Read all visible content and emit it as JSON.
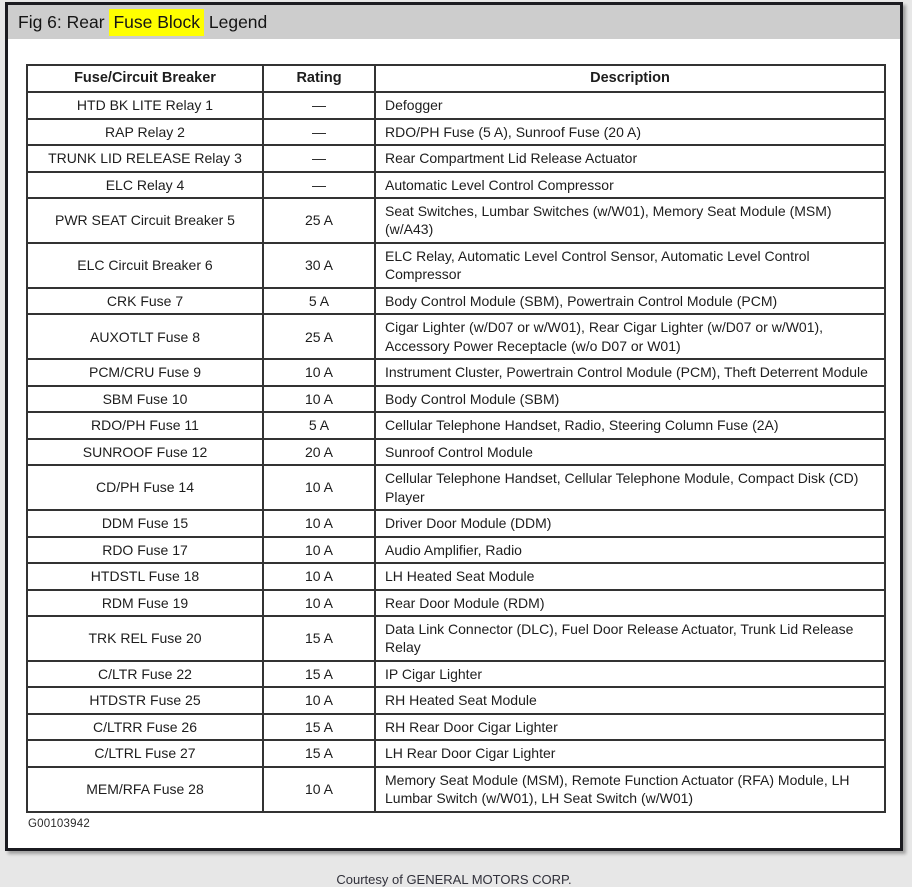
{
  "title": {
    "prefix": "Fig 6: Rear ",
    "highlight": "Fuse Block",
    "suffix": " Legend"
  },
  "colors": {
    "highlight": "#ffff00",
    "title_bar_bg": "#cdcdcd",
    "frame_border": "#1b1b20",
    "table_border": "#333333",
    "page_edge": "#e7e7e7"
  },
  "table": {
    "headers": [
      "Fuse/Circuit Breaker",
      "Rating",
      "Description"
    ],
    "rows": [
      {
        "fuse": "HTD BK LITE Relay 1",
        "rating": "—",
        "description": "Defogger"
      },
      {
        "fuse": "RAP Relay 2",
        "rating": "—",
        "description": "RDO/PH Fuse (5 A), Sunroof Fuse (20 A)"
      },
      {
        "fuse": "TRUNK LID RELEASE Relay 3",
        "rating": "—",
        "description": "Rear Compartment Lid Release Actuator"
      },
      {
        "fuse": "ELC Relay 4",
        "rating": "—",
        "description": "Automatic Level Control Compressor"
      },
      {
        "fuse": "PWR SEAT Circuit Breaker 5",
        "rating": "25 A",
        "description": "Seat Switches, Lumbar Switches (w/W01), Memory Seat Module (MSM) (w/A43)"
      },
      {
        "fuse": "ELC Circuit Breaker 6",
        "rating": "30 A",
        "description": "ELC Relay, Automatic Level Control Sensor, Automatic Level Control Compressor"
      },
      {
        "fuse": "CRK Fuse 7",
        "rating": "5 A",
        "description": "Body Control Module (SBM), Powertrain Control Module (PCM)"
      },
      {
        "fuse": "AUXOTLT Fuse 8",
        "rating": "25 A",
        "description": "Cigar Lighter (w/D07 or w/W01), Rear Cigar Lighter (w/D07 or w/W01), Accessory Power Receptacle (w/o D07 or W01)"
      },
      {
        "fuse": "PCM/CRU Fuse 9",
        "rating": "10 A",
        "description": "Instrument Cluster, Powertrain Control Module (PCM), Theft Deterrent Module"
      },
      {
        "fuse": "SBM Fuse 10",
        "rating": "10 A",
        "description": "Body Control Module (SBM)"
      },
      {
        "fuse": "RDO/PH Fuse 11",
        "rating": "5 A",
        "description": "Cellular Telephone Handset, Radio, Steering Column Fuse (2A)"
      },
      {
        "fuse": "SUNROOF Fuse 12",
        "rating": "20 A",
        "description": "Sunroof Control Module"
      },
      {
        "fuse": "CD/PH Fuse 14",
        "rating": "10 A",
        "description": "Cellular Telephone Handset, Cellular Telephone Module, Compact Disk (CD) Player"
      },
      {
        "fuse": "DDM Fuse 15",
        "rating": "10 A",
        "description": "Driver Door Module (DDM)"
      },
      {
        "fuse": "RDO Fuse 17",
        "rating": "10 A",
        "description": "Audio Amplifier, Radio"
      },
      {
        "fuse": "HTDSTL Fuse 18",
        "rating": "10 A",
        "description": "LH Heated Seat Module"
      },
      {
        "fuse": "RDM Fuse 19",
        "rating": "10 A",
        "description": "Rear Door Module (RDM)"
      },
      {
        "fuse": "TRK REL Fuse 20",
        "rating": "15 A",
        "description": "Data Link Connector (DLC), Fuel Door Release Actuator, Trunk Lid Release Relay"
      },
      {
        "fuse": "C/LTR Fuse 22",
        "rating": "15 A",
        "description": "IP Cigar Lighter"
      },
      {
        "fuse": "HTDSTR Fuse 25",
        "rating": "10 A",
        "description": "RH Heated Seat Module"
      },
      {
        "fuse": "C/LTRR Fuse 26",
        "rating": "15 A",
        "description": "RH Rear Door Cigar Lighter"
      },
      {
        "fuse": "C/LTRL Fuse 27",
        "rating": "15 A",
        "description": "LH Rear Door Cigar Lighter"
      },
      {
        "fuse": "MEM/RFA Fuse 28",
        "rating": "10 A",
        "description": "Memory Seat Module (MSM), Remote Function Actuator (RFA) Module, LH Lumbar Switch (w/W01), LH Seat Switch (w/W01)"
      }
    ]
  },
  "footer": {
    "figure_code": "G00103942",
    "courtesy": "Courtesy of GENERAL MOTORS CORP."
  }
}
